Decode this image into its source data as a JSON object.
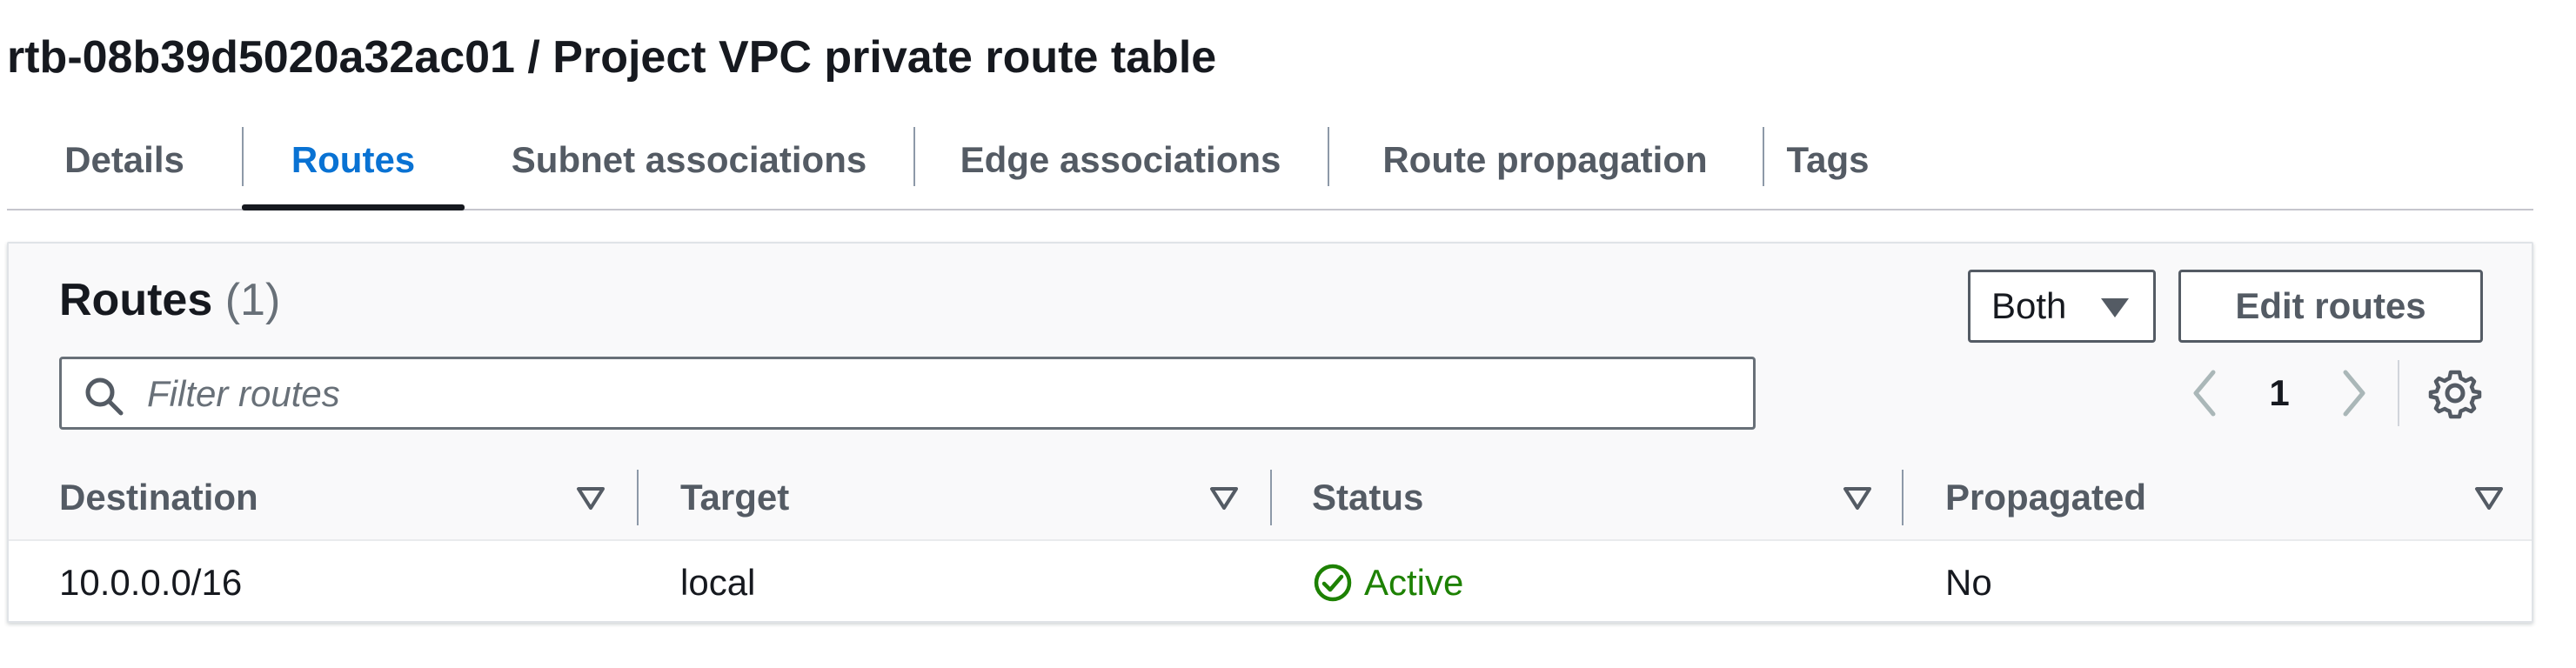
{
  "page": {
    "title": "rtb-08b39d5020a32ac01 / Project VPC private route table"
  },
  "tabs": [
    {
      "label": "Details",
      "active": false
    },
    {
      "label": "Routes",
      "active": true
    },
    {
      "label": "Subnet associations",
      "active": false
    },
    {
      "label": "Edge associations",
      "active": false
    },
    {
      "label": "Route propagation",
      "active": false
    },
    {
      "label": "Tags",
      "active": false
    }
  ],
  "routes_panel": {
    "title": "Routes",
    "count": "(1)",
    "filter_dropdown": {
      "selected": "Both"
    },
    "edit_button_label": "Edit routes",
    "search": {
      "placeholder": "Filter routes",
      "value": ""
    },
    "pagination": {
      "current_page": "1"
    },
    "icons": {
      "search": "search-icon",
      "prev": "chevron-left-icon",
      "next": "chevron-right-icon",
      "settings": "gear-icon",
      "sort": "sort-triangle-down-icon",
      "status_active": "check-circle-icon"
    }
  },
  "table": {
    "columns": [
      "Destination",
      "Target",
      "Status",
      "Propagated"
    ],
    "rows": [
      {
        "destination": "10.0.0.0/16",
        "target": "local",
        "status": "Active",
        "propagated": "No"
      }
    ]
  },
  "colors": {
    "tab_active": "#0972d3",
    "status_active": "#1d8102",
    "text_primary": "#16191f",
    "text_secondary": "#545b64"
  }
}
